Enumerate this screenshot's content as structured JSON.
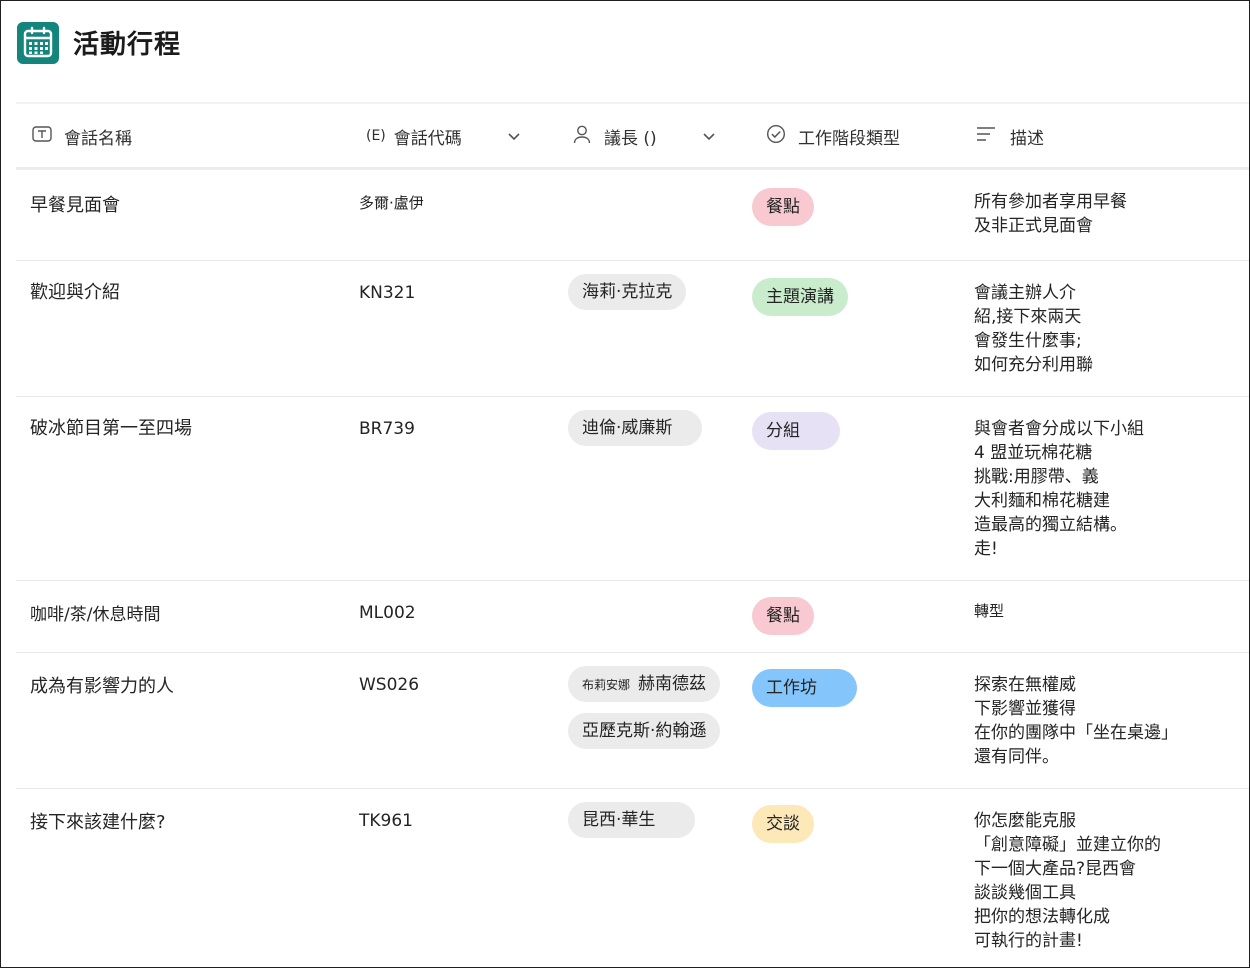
{
  "app": {
    "title": "活動行程",
    "icon": "calendar-icon",
    "accent": "#14857c"
  },
  "columns": {
    "name": {
      "label": "會話名稱",
      "icon": "text-field-icon"
    },
    "code": {
      "label": "會話代碼",
      "prefix": "(E)"
    },
    "chair": {
      "label": "議長 ()",
      "icon": "person-icon"
    },
    "type": {
      "label": "工作階段類型",
      "icon": "check-circle-icon"
    },
    "desc": {
      "label": "描述",
      "icon": "multiline-text-icon"
    }
  },
  "rows": [
    {
      "name": "早餐見面會",
      "code": "多爾·盧伊",
      "chairs": [],
      "type": {
        "label": "餐點",
        "color": "#f8c9d0"
      },
      "desc": "所有參加者享用早餐\n及非正式見面會"
    },
    {
      "name": "歡迎與介紹",
      "code": "KN321",
      "chairs": [
        {
          "name": "海莉·克拉克"
        }
      ],
      "type": {
        "label": "主題演講",
        "color": "#c9eccc"
      },
      "desc": "會議主辦人介\n紹,接下來兩天\n會發生什麼事;\n如何充分利用聯"
    },
    {
      "name": "破冰節目第一至四場",
      "code": "BR739",
      "chairs": [
        {
          "name": "迪倫·威廉斯"
        }
      ],
      "type": {
        "label": "分組",
        "color": "#e7e1f5"
      },
      "desc": "與會者會分成以下小組\n4 盟並玩棉花糖\n挑戰:用膠帶、義\n大利麵和棉花糖建\n造最高的獨立結構。\n走!"
    },
    {
      "name": "咖啡/茶/休息時間",
      "code": "ML002",
      "chairs": [],
      "type": {
        "label": "餐點",
        "color": "#f8c9d0"
      },
      "desc": "轉型"
    },
    {
      "name": "成為有影響力的人",
      "code": "WS026",
      "chairs": [
        {
          "prefix": "布莉安娜",
          "name": "赫南德茲"
        },
        {
          "name": "亞歷克斯·約翰遜"
        }
      ],
      "type": {
        "label": "工作坊",
        "color": "#84c5fb"
      },
      "desc": "探索在無權威\n下影響並獲得\n在你的團隊中「坐在桌邊」\n還有同伴。"
    },
    {
      "name": "接下來該建什麼?",
      "code": "TK961",
      "chairs": [
        {
          "name": "昆西·華生"
        }
      ],
      "type": {
        "label": "交談",
        "color": "#fde8b8"
      },
      "desc": "你怎麼能克服\n「創意障礙」並建立你的\n下一個大產品?昆西會\n談談幾個工具\n把你的想法轉化成\n可執行的計畫!"
    }
  ]
}
